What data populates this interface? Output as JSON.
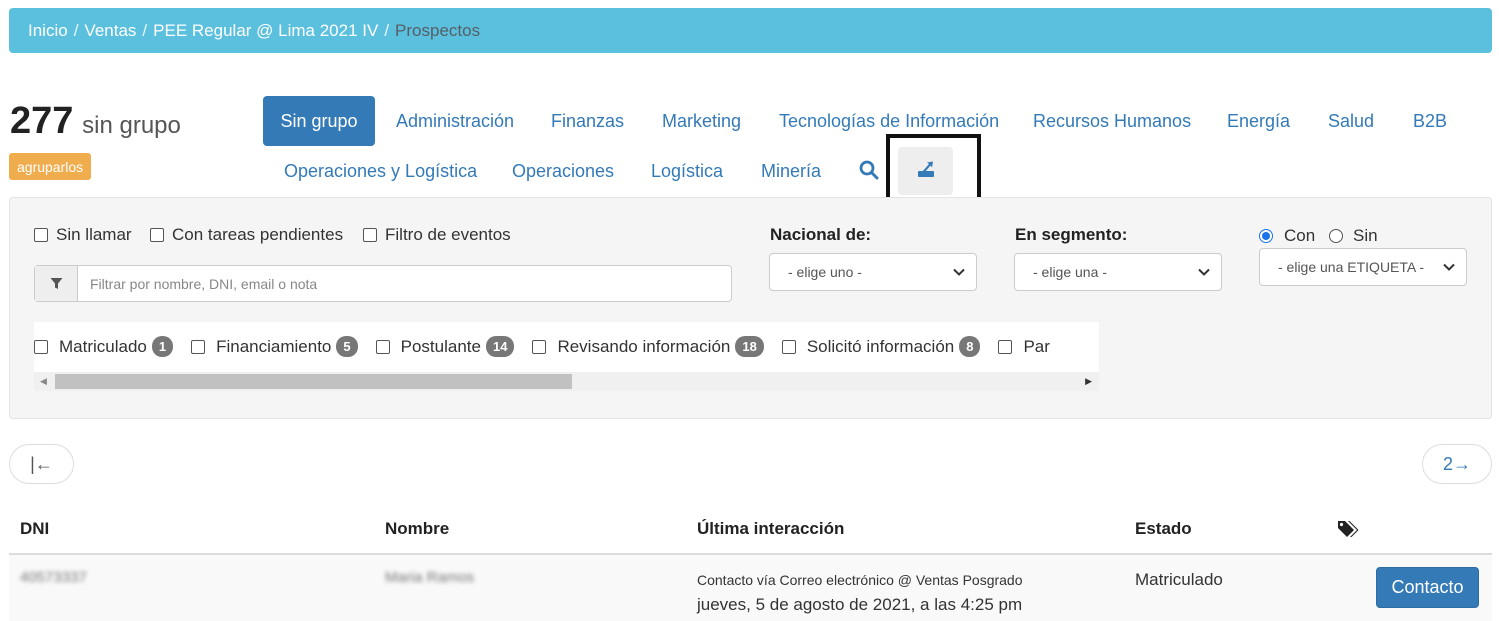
{
  "breadcrumb": {
    "items": [
      "Inicio",
      "Ventas",
      "PEE Regular @ Lima 2021 IV"
    ],
    "current": "Prospectos"
  },
  "summary": {
    "count": "277",
    "count_label": "sin grupo",
    "group_button": "agruparlos"
  },
  "tabs": {
    "active": "Sin grupo",
    "row1": [
      "Administración",
      "Finanzas",
      "Marketing",
      "Tecnologías de Información",
      "Recursos Humanos",
      "Energía",
      "Salud",
      "B2B"
    ],
    "row2": [
      "Operaciones y Logística",
      "Operaciones",
      "Logística",
      "Minería"
    ]
  },
  "filters": {
    "checks": [
      "Sin llamar",
      "Con tareas pendientes",
      "Filtro de eventos"
    ],
    "search_placeholder": "Filtrar por nombre, DNI, email o nota",
    "nacional_label": "Nacional de:",
    "nacional_value": "- elige uno -",
    "segmento_label": "En segmento:",
    "segmento_value": "- elige una -",
    "radio_con": "Con",
    "radio_sin": "Sin",
    "etiqueta_value": "- elige una ETIQUETA -"
  },
  "statuses": [
    {
      "label": "Matriculado",
      "count": "1"
    },
    {
      "label": "Financiamiento",
      "count": "5"
    },
    {
      "label": "Postulante",
      "count": "14"
    },
    {
      "label": "Revisando información",
      "count": "18"
    },
    {
      "label": "Solicitó información",
      "count": "8"
    },
    {
      "label": "Par",
      "count": ""
    }
  ],
  "pagination": {
    "first": "|←",
    "next": "2→"
  },
  "table": {
    "headers": [
      "DNI",
      "Nombre",
      "Última interacción",
      "Estado"
    ],
    "rows": [
      {
        "dni": "40573337",
        "nombre": "Maria Ramos",
        "interaccion_canal": "Contacto vía Correo electrónico @ Ventas Posgrado",
        "interaccion_fecha": "jueves, 5 de agosto de 2021, a las 4:25 pm",
        "estado": "Matriculado",
        "accion": "Contacto"
      }
    ]
  },
  "colors": {
    "breadcrumb_bg": "#5bc0de",
    "primary": "#337ab7",
    "warning": "#f0ad4e",
    "badge": "#777777"
  }
}
